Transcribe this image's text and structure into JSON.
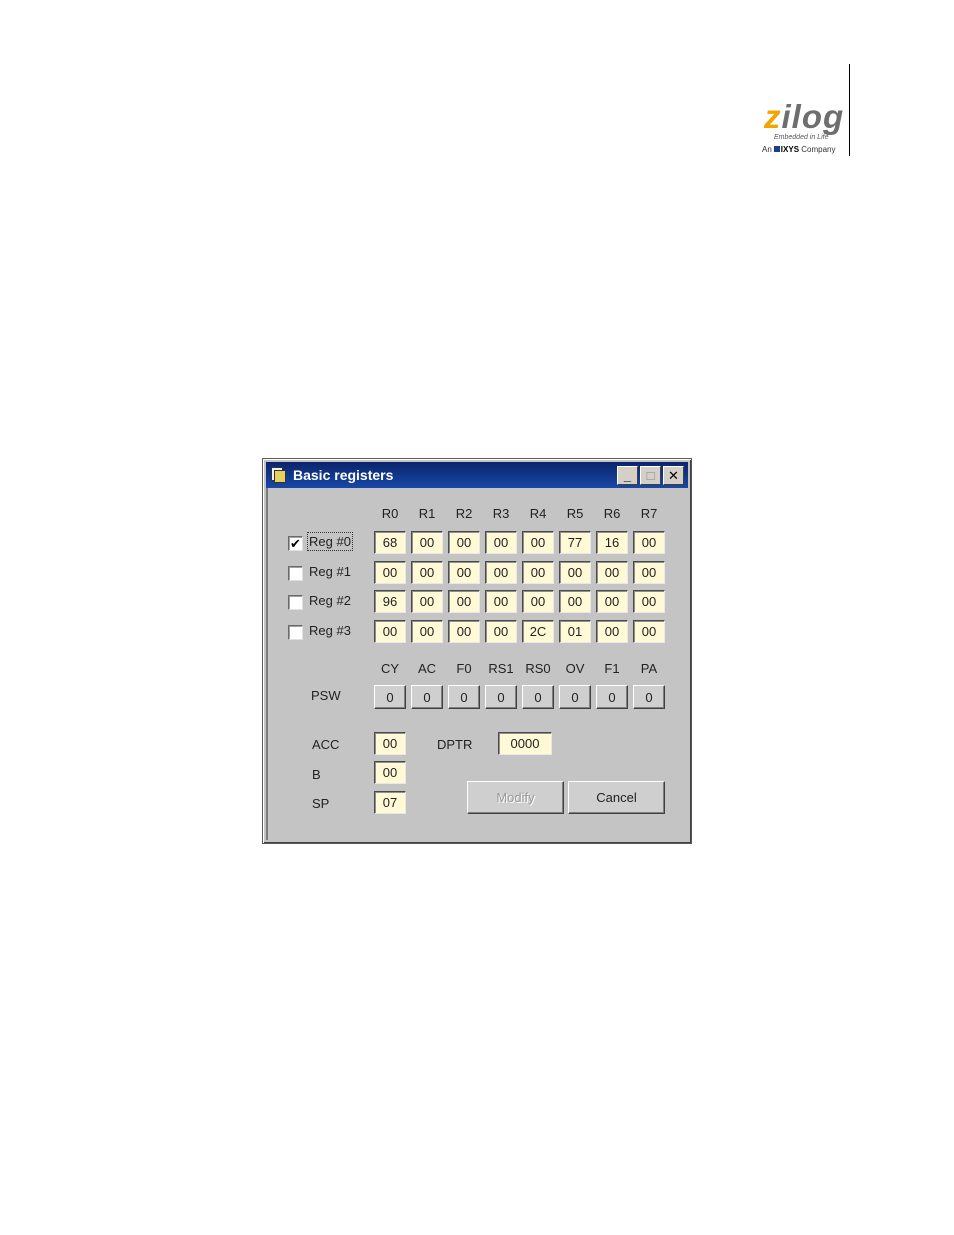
{
  "logo": {
    "wordmark_z": "z",
    "wordmark_rest": "ilog",
    "tagline": "Embedded in Life",
    "company_prefix": "An",
    "company_name": "IXYS",
    "company_suffix": "Company"
  },
  "window": {
    "title": "Basic registers",
    "minimize": "_",
    "maximize": "□",
    "close": "✕"
  },
  "registers": {
    "columns": [
      "R0",
      "R1",
      "R2",
      "R3",
      "R4",
      "R5",
      "R6",
      "R7"
    ],
    "banks": [
      {
        "label": "Reg #0",
        "checked": true,
        "mark": "✔",
        "values": [
          "68",
          "00",
          "00",
          "00",
          "00",
          "77",
          "16",
          "00"
        ]
      },
      {
        "label": "Reg #1",
        "checked": false,
        "mark": "",
        "values": [
          "00",
          "00",
          "00",
          "00",
          "00",
          "00",
          "00",
          "00"
        ]
      },
      {
        "label": "Reg #2",
        "checked": false,
        "mark": "",
        "values": [
          "96",
          "00",
          "00",
          "00",
          "00",
          "00",
          "00",
          "00"
        ]
      },
      {
        "label": "Reg #3",
        "checked": false,
        "mark": "",
        "values": [
          "00",
          "00",
          "00",
          "00",
          "2C",
          "01",
          "00",
          "00"
        ]
      }
    ]
  },
  "psw": {
    "label": "PSW",
    "flags": [
      "CY",
      "AC",
      "F0",
      "RS1",
      "RS0",
      "OV",
      "F1",
      "PA"
    ],
    "values": [
      "0",
      "0",
      "0",
      "0",
      "0",
      "0",
      "0",
      "0"
    ]
  },
  "acc": {
    "label": "ACC",
    "value": "00"
  },
  "b": {
    "label": "B",
    "value": "00"
  },
  "sp": {
    "label": "SP",
    "value": "07"
  },
  "dptr": {
    "label": "DPTR",
    "value": "0000"
  },
  "buttons": {
    "modify": "Modify",
    "cancel": "Cancel"
  }
}
